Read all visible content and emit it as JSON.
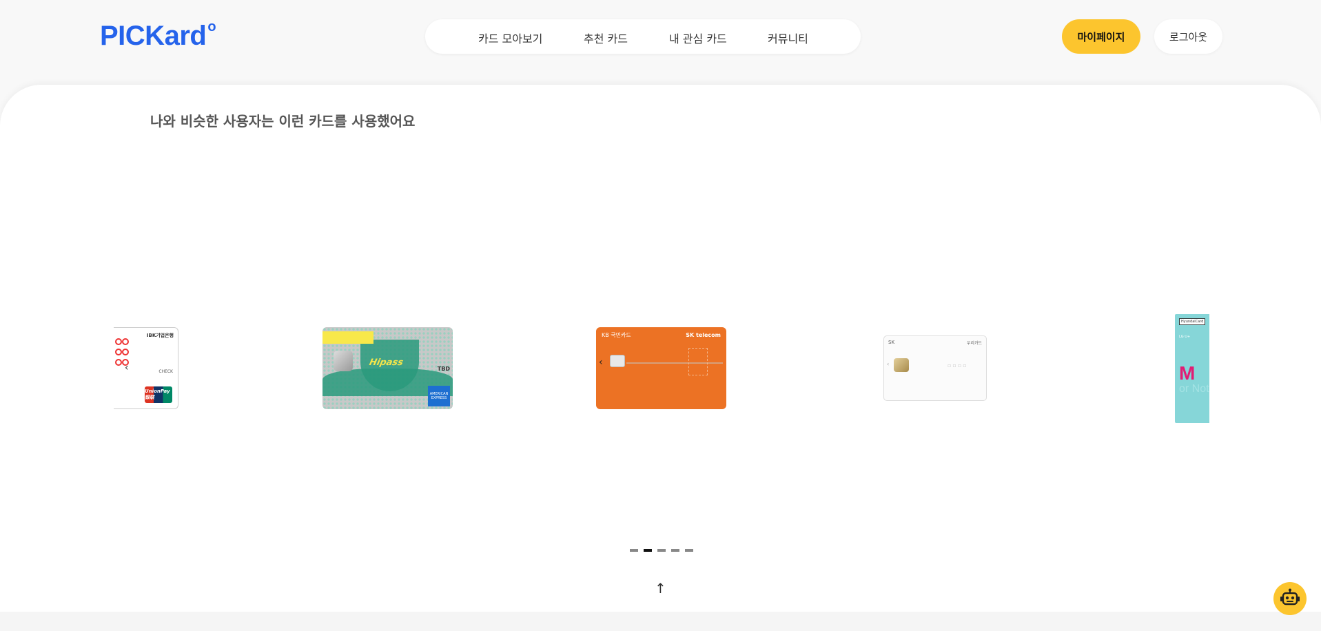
{
  "header": {
    "logo_text": "PICKard",
    "logo_mark": "o",
    "nav": [
      "카드 모아보기",
      "추천 카드",
      "내 관심 카드",
      "커뮤니티"
    ],
    "mypage_label": "마이페이지",
    "logout_label": "로그아웃"
  },
  "main": {
    "section_title": "나와 비슷한 사용자는 이런 카드를 사용했어요",
    "cards": [
      {
        "bank": "IBK기업은행",
        "label": "CHECK",
        "network": "UnionPay 银联"
      },
      {
        "script": "Hipass",
        "tag": "TBD",
        "network": "AMERICAN EXPRESS"
      },
      {
        "bank": "KB 국민카드",
        "partner": "SK telecom"
      },
      {
        "bank": "SK",
        "partner": "우리카드"
      },
      {
        "bank": "HyundaiCard",
        "sub": "LG U+",
        "mark": "M",
        "text": "or Nothin"
      }
    ],
    "pagination": {
      "count": 5,
      "active_index": 1
    }
  },
  "to_top_label": "↑",
  "colors": {
    "brand": "#2563eb",
    "accent": "#fcc52e"
  },
  "icons": {
    "chatbot": "robot-icon"
  }
}
